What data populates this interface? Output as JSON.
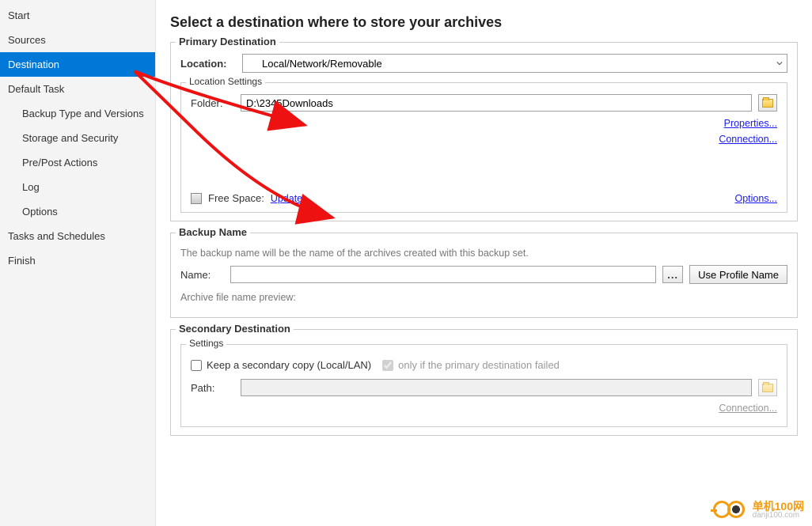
{
  "sidebar": {
    "items": [
      {
        "label": "Start",
        "selected": false,
        "indent": false
      },
      {
        "label": "Sources",
        "selected": false,
        "indent": false
      },
      {
        "label": "Destination",
        "selected": true,
        "indent": false
      },
      {
        "label": "Default Task",
        "selected": false,
        "indent": false
      },
      {
        "label": "Backup Type and Versions",
        "selected": false,
        "indent": true
      },
      {
        "label": "Storage and Security",
        "selected": false,
        "indent": true
      },
      {
        "label": "Pre/Post Actions",
        "selected": false,
        "indent": true
      },
      {
        "label": "Log",
        "selected": false,
        "indent": true
      },
      {
        "label": "Options",
        "selected": false,
        "indent": true
      },
      {
        "label": "Tasks and Schedules",
        "selected": false,
        "indent": false
      },
      {
        "label": "Finish",
        "selected": false,
        "indent": false
      }
    ]
  },
  "page": {
    "title": "Select a destination where to store your archives"
  },
  "primary": {
    "legend": "Primary Destination",
    "location_label": "Location:",
    "location_value": "Local/Network/Removable",
    "loc_settings_legend": "Location Settings",
    "folder_label": "Folder:",
    "folder_value": "D:\\2345Downloads",
    "properties_link": "Properties...",
    "connection_link": "Connection...",
    "free_space_label": "Free Space:",
    "update_link": "Update...",
    "options_link": "Options..."
  },
  "backup_name": {
    "legend": "Backup Name",
    "desc": "The backup name will be the name of the archives created with this backup set.",
    "name_label": "Name:",
    "name_value": "",
    "use_profile_btn": "Use Profile Name",
    "preview_label": "Archive file name preview:"
  },
  "secondary": {
    "legend": "Secondary Destination",
    "settings_legend": "Settings",
    "keep_copy_label": "Keep a secondary copy (Local/LAN)",
    "keep_copy_checked": false,
    "only_if_label": "only if the primary destination failed",
    "only_if_checked": true,
    "path_label": "Path:",
    "path_value": "",
    "connection_link": "Connection..."
  },
  "watermark": {
    "line1": "单机100网",
    "line2": "danji100.com"
  }
}
